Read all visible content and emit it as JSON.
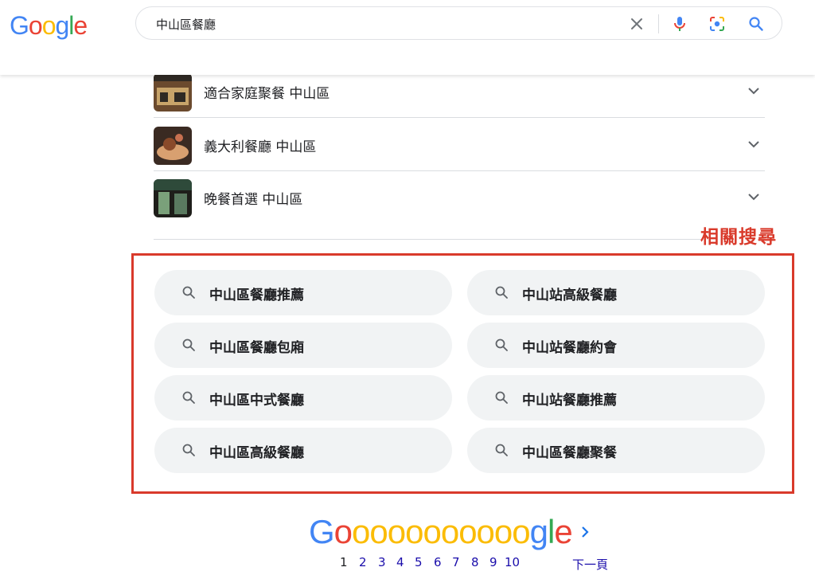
{
  "logo": {
    "letters": [
      "G",
      "o",
      "o",
      "g",
      "l",
      "e"
    ],
    "colors": [
      "#4285F4",
      "#EA4335",
      "#FBBC05",
      "#4285F4",
      "#34A853",
      "#EA4335"
    ]
  },
  "search": {
    "query": "中山區餐廳",
    "icons": [
      "clear-icon",
      "microphone-icon",
      "lens-icon",
      "search-icon"
    ]
  },
  "accordion": [
    {
      "label": "適合家庭聚餐 中山區",
      "thumb_colors": [
        "#6b4a2e",
        "#c8a46a",
        "#2f2a24"
      ]
    },
    {
      "label": "義大利餐廳 中山區",
      "thumb_colors": [
        "#8a4a2a",
        "#d8a070",
        "#3a2a22"
      ]
    },
    {
      "label": "晚餐首選 中山區",
      "thumb_colors": [
        "#2e4a3a",
        "#7aa07a",
        "#1e1e1a"
      ]
    }
  ],
  "annotation": {
    "label": "相關搜尋",
    "color": "#d93a2b"
  },
  "related_searches": [
    "中山區餐廳推薦",
    "中山站高級餐廳",
    "中山區餐廳包廂",
    "中山站餐廳約會",
    "中山區中式餐廳",
    "中山站餐廳推薦",
    "中山區高級餐廳",
    "中山區餐廳聚餐"
  ],
  "pagination": {
    "logo_letters": [
      "G",
      "o",
      "o",
      "o",
      "o",
      "o",
      "o",
      "o",
      "o",
      "o",
      "o",
      "o",
      "g",
      "l",
      "e"
    ],
    "logo_colors": [
      "#4285F4",
      "#EA4335",
      "#FBBC05",
      "#FBBC05",
      "#FBBC05",
      "#FBBC05",
      "#FBBC05",
      "#FBBC05",
      "#FBBC05",
      "#FBBC05",
      "#FBBC05",
      "#FBBC05",
      "#4285F4",
      "#34A853",
      "#EA4335"
    ],
    "current": "1",
    "pages": [
      "1",
      "2",
      "3",
      "4",
      "5",
      "6",
      "7",
      "8",
      "9",
      "10"
    ],
    "next_label": "下一頁"
  }
}
